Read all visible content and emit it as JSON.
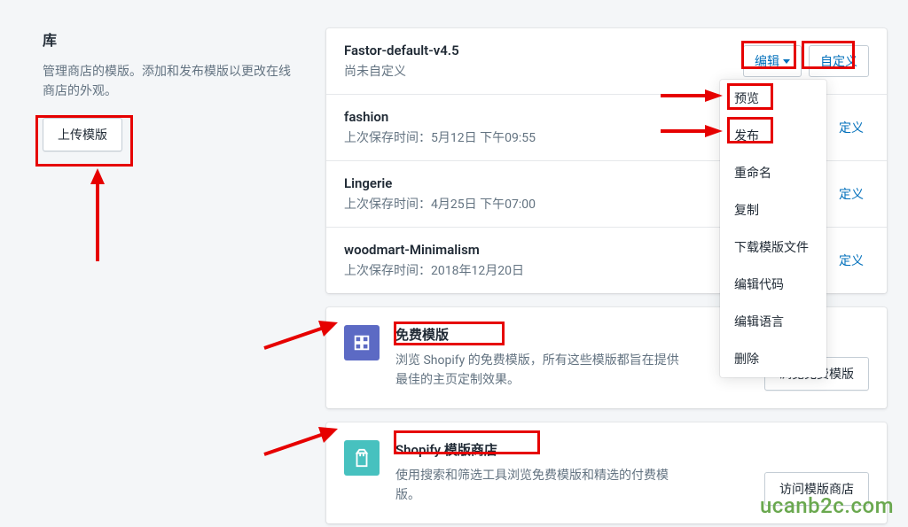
{
  "library": {
    "title": "库",
    "description": "管理商店的模版。添加和发布模版以更改在线商店的外观。",
    "upload_label": "上传模版"
  },
  "themes": {
    "actions": {
      "edit": "编辑",
      "customize": "自定义",
      "customize_short": "定义"
    },
    "items": [
      {
        "name": "Fastor-default-v4.5",
        "meta": "尚未自定义"
      },
      {
        "name": "fashion",
        "meta": "上次保存时间：5月12日 下午09:55"
      },
      {
        "name": "Lingerie",
        "meta": "上次保存时间：4月25日 下午07:00"
      },
      {
        "name": "woodmart-Minimalism",
        "meta": "上次保存时间：2018年12月20日"
      }
    ]
  },
  "dropdown": {
    "items": [
      "预览",
      "发布",
      "重命名",
      "复制",
      "下载模版文件",
      "编辑代码",
      "编辑语言",
      "删除"
    ]
  },
  "promos": {
    "free": {
      "title": "免费模版",
      "desc": "浏览 Shopify 的免费模版，所有这些模版都旨在提供最佳的主页定制效果。",
      "button": "浏览免费模版"
    },
    "store": {
      "title": "Shopify 模版商店",
      "desc": "使用搜索和筛选工具浏览免费模版和精选的付费模版。",
      "button": "访问模版商店"
    }
  },
  "watermark": "ucanb2c.com"
}
